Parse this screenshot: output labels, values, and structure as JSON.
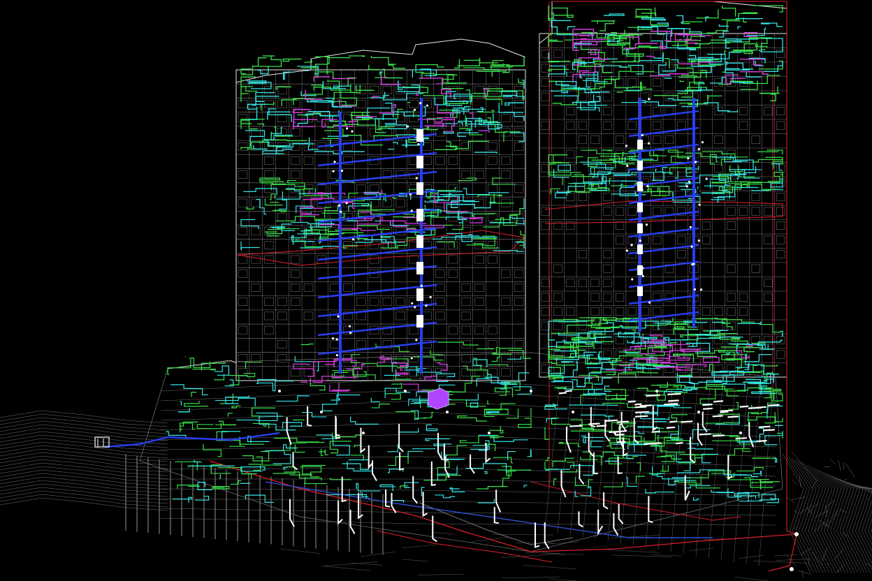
{
  "view": {
    "title": "",
    "background_color": "#000000"
  },
  "palette": {
    "structure_line": "#e8e8e8",
    "structure_dim": "#7a7a7a",
    "terrain_line": "#9a9a9a",
    "boundary_red": "#e0202a",
    "pipe_green": "#39e04a",
    "pipe_cyan": "#36e6e6",
    "pipe_blue": "#2a3ef0",
    "pipe_magenta": "#d23cdc",
    "pipe_white": "#ffffff",
    "equipment_purple": "#b044ff"
  },
  "model": {
    "towers": [
      "left-tower",
      "right-tower"
    ],
    "systems": [
      "structure",
      "site-boundary",
      "drainage-pipes",
      "water-pipes",
      "vertical-risers",
      "pipe-fittings",
      "equipment",
      "terrain"
    ]
  }
}
